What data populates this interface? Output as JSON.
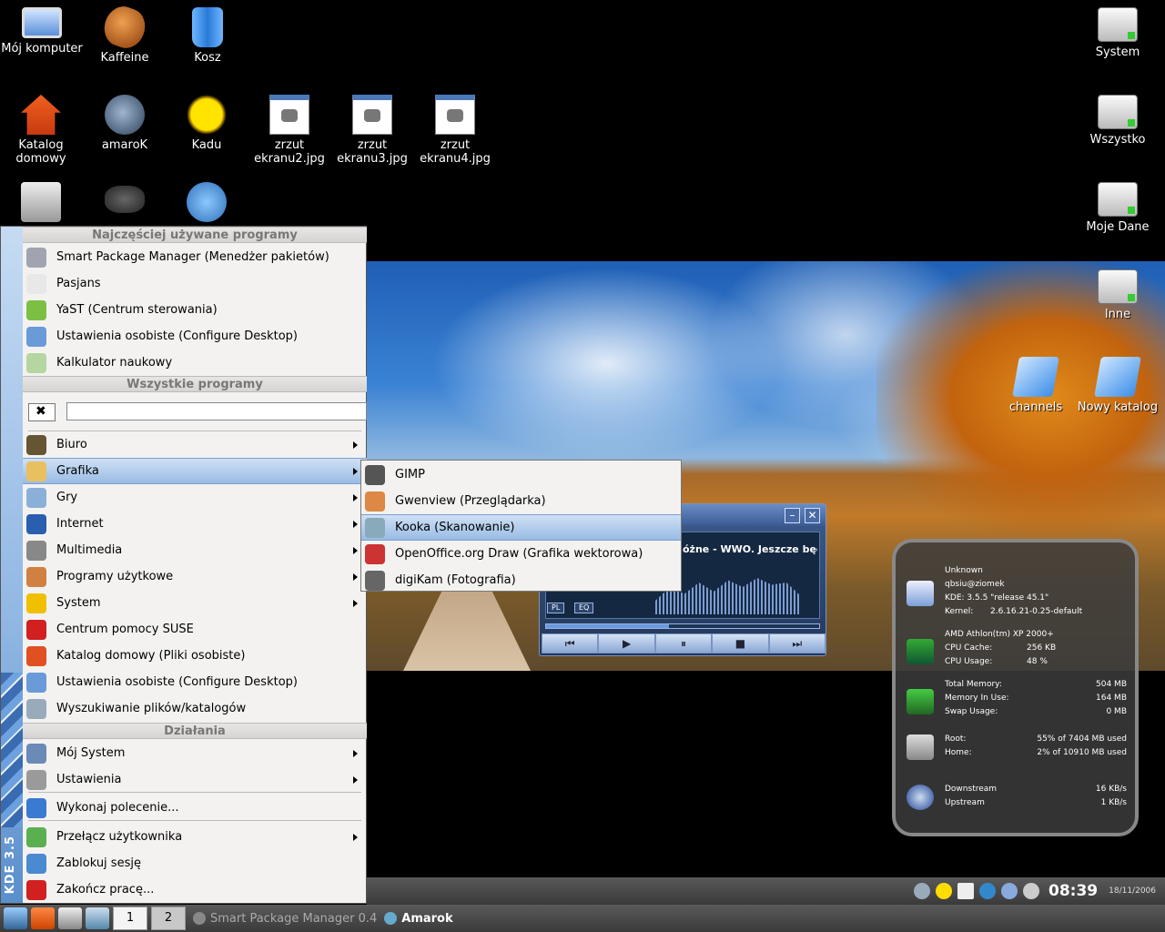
{
  "desktop": {
    "icons": [
      {
        "label": "Mój komputer",
        "icon": "computer-icon"
      },
      {
        "label": "Kaffeine",
        "icon": "kaffeine-icon"
      },
      {
        "label": "Kosz",
        "icon": "trash-icon"
      },
      {
        "label": "Katalog domowy",
        "icon": "home-folder-icon"
      },
      {
        "label": "amaroK",
        "icon": "amarok-wolf-icon"
      },
      {
        "label": "Kadu",
        "icon": "kadu-sun-icon"
      },
      {
        "label": "zrzut ekranu2.jpg",
        "icon": "image-file-icon"
      },
      {
        "label": "zrzut ekranu3.jpg",
        "icon": "image-file-icon"
      },
      {
        "label": "zrzut ekranu4.jpg",
        "icon": "image-file-icon"
      },
      {
        "label": "System",
        "icon": "drive-icon"
      },
      {
        "label": "Wszystko",
        "icon": "drive-icon"
      },
      {
        "label": "Moje Dane",
        "icon": "drive-icon"
      },
      {
        "label": "Inne",
        "icon": "drive-icon"
      },
      {
        "label": "channels",
        "icon": "folder-icon"
      },
      {
        "label": "Nowy katalog",
        "icon": "folder-icon"
      }
    ]
  },
  "kmenu": {
    "sidebar_label": "KDE 3.5",
    "section_frequent": "Najczęściej używane programy",
    "frequent": [
      {
        "label": "Smart Package Manager (Menedżer pakietów)",
        "icon": "package-manager-icon"
      },
      {
        "label": "Pasjans",
        "icon": "cards-icon"
      },
      {
        "label": "YaST (Centrum sterowania)",
        "icon": "yast-icon"
      },
      {
        "label": "Ustawienia osobiste (Configure Desktop)",
        "icon": "settings-monitor-icon"
      },
      {
        "label": "Kalkulator naukowy",
        "icon": "calculator-icon"
      }
    ],
    "section_all": "Wszystkie programy",
    "search": {
      "value": "",
      "placeholder": ""
    },
    "categories": [
      {
        "label": "Biuro",
        "icon": "office-icon",
        "has_sub": true
      },
      {
        "label": "Grafika",
        "icon": "graphics-icon",
        "has_sub": true
      },
      {
        "label": "Gry",
        "icon": "games-icon",
        "has_sub": true
      },
      {
        "label": "Internet",
        "icon": "internet-globe-icon",
        "has_sub": true
      },
      {
        "label": "Multimedia",
        "icon": "multimedia-icon",
        "has_sub": true
      },
      {
        "label": "Programy użytkowe",
        "icon": "utilities-icon",
        "has_sub": true
      },
      {
        "label": "System",
        "icon": "system-icon",
        "has_sub": true
      },
      {
        "label": "Centrum pomocy SUSE",
        "icon": "help-lifebuoy-icon",
        "has_sub": false
      },
      {
        "label": "Katalog domowy (Pliki osobiste)",
        "icon": "home-icon",
        "has_sub": false
      },
      {
        "label": "Ustawienia osobiste (Configure Desktop)",
        "icon": "settings-monitor-icon",
        "has_sub": false
      },
      {
        "label": "Wyszukiwanie plików/katalogów",
        "icon": "find-icon",
        "has_sub": false
      }
    ],
    "section_actions": "Działania",
    "actions": [
      {
        "label": "Mój System",
        "icon": "my-system-icon",
        "has_sub": true
      },
      {
        "label": "Ustawienia",
        "icon": "wrench-icon",
        "has_sub": true
      },
      {
        "label": "Wykonaj polecenie...",
        "icon": "run-command-icon",
        "has_sub": false
      },
      {
        "label": "Przełącz użytkownika",
        "icon": "switch-user-icon",
        "has_sub": true
      },
      {
        "label": "Zablokuj sesję",
        "icon": "lock-icon",
        "has_sub": false
      },
      {
        "label": "Zakończ pracę...",
        "icon": "logout-icon",
        "has_sub": false
      }
    ]
  },
  "submenu": {
    "items": [
      {
        "label": "GIMP",
        "icon": "gimp-icon"
      },
      {
        "label": "Gwenview (Przeglądarka)",
        "icon": "gwenview-icon"
      },
      {
        "label": "Kooka (Skanowanie)",
        "icon": "scanner-icon"
      },
      {
        "label": "OpenOffice.org Draw (Grafika wektorowa)",
        "icon": "oo-draw-icon"
      },
      {
        "label": "digiKam (Fotografia)",
        "icon": "camera-icon"
      }
    ]
  },
  "amarok": {
    "track": "óżne - WWO. Jeszcze będzie",
    "pl_label": "PL",
    "eq_label": "EQ",
    "progress": 0.45
  },
  "sysmon": {
    "host": [
      "Unknown",
      "qbsiu@ziomek",
      "KDE: 3.5.5 \"release 45.1\""
    ],
    "kernel": {
      "k": "Kernel:",
      "v": "2.6.16.21-0.25-default"
    },
    "cpu": {
      "model": "AMD Athlon(tm) XP 2000+",
      "cache_k": "CPU Cache:",
      "cache_v": "256 KB",
      "usage_k": "CPU Usage:",
      "usage_v": "48 %"
    },
    "mem": [
      {
        "k": "Total Memory:",
        "v": "504 MB"
      },
      {
        "k": "Memory In Use:",
        "v": "164 MB"
      },
      {
        "k": "Swap Usage:",
        "v": "0 MB"
      }
    ],
    "disk": [
      {
        "k": "Root:",
        "v": "55% of 7404 MB used"
      },
      {
        "k": "Home:",
        "v": "2% of 10910 MB used"
      }
    ],
    "net": [
      {
        "k": "Downstream",
        "v": "16 KB/s"
      },
      {
        "k": "Upstream",
        "v": "1 KB/s"
      }
    ]
  },
  "taskbar": {
    "clock": "08:39",
    "date": "18/11/2006",
    "pager": [
      "1",
      "2"
    ],
    "tasks": [
      {
        "label": "Smart Package Manager 0.4",
        "active": false
      },
      {
        "label": "Amarok",
        "active": true
      }
    ]
  }
}
